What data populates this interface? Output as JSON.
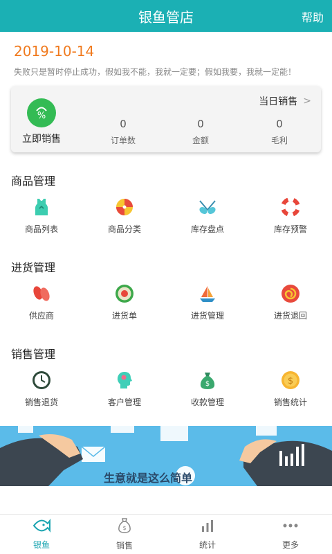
{
  "header": {
    "title": "银鱼管店",
    "help": "帮助"
  },
  "date": "2019-10-14",
  "motto": "失败只是暂时停止成功，假如我不能，我就一定要；假如我要，我就一定能！",
  "sales_card": {
    "quick_sale": "立即销售",
    "today_link": "当日销售",
    "stats": [
      {
        "value": "0",
        "label": "订单数"
      },
      {
        "value": "0",
        "label": "金额"
      },
      {
        "value": "0",
        "label": "毛利"
      }
    ]
  },
  "sections": [
    {
      "title": "商品管理",
      "items": [
        {
          "label": "商品列表",
          "icon": "tank-top-icon"
        },
        {
          "label": "商品分类",
          "icon": "beach-ball-icon"
        },
        {
          "label": "库存盘点",
          "icon": "sunglasses-icon"
        },
        {
          "label": "库存预警",
          "icon": "lifebuoy-icon"
        }
      ]
    },
    {
      "title": "进货管理",
      "items": [
        {
          "label": "供应商",
          "icon": "flip-flops-icon"
        },
        {
          "label": "进货单",
          "icon": "badge-icon"
        },
        {
          "label": "进货管理",
          "icon": "sailboat-icon"
        },
        {
          "label": "进货退回",
          "icon": "swirl-icon"
        }
      ]
    },
    {
      "title": "销售管理",
      "items": [
        {
          "label": "销售退货",
          "icon": "clock-icon"
        },
        {
          "label": "客户管理",
          "icon": "head-icon"
        },
        {
          "label": "收款管理",
          "icon": "money-bag-icon"
        },
        {
          "label": "销售统计",
          "icon": "coin-icon"
        }
      ]
    }
  ],
  "banner": {
    "slogan": "生意就是这么简单"
  },
  "tabbar": [
    {
      "label": "银鱼",
      "icon": "fish-icon",
      "active": true
    },
    {
      "label": "销售",
      "icon": "money-bag-outline-icon",
      "active": false
    },
    {
      "label": "统计",
      "icon": "bar-chart-icon",
      "active": false
    },
    {
      "label": "更多",
      "icon": "more-dots-icon",
      "active": false
    }
  ],
  "colors": {
    "header": "#1bb0b4",
    "date": "#f07a1e",
    "banner": "#5bbbe9",
    "accent": "#1aa4b0",
    "quick_sale": "#33bb54"
  }
}
